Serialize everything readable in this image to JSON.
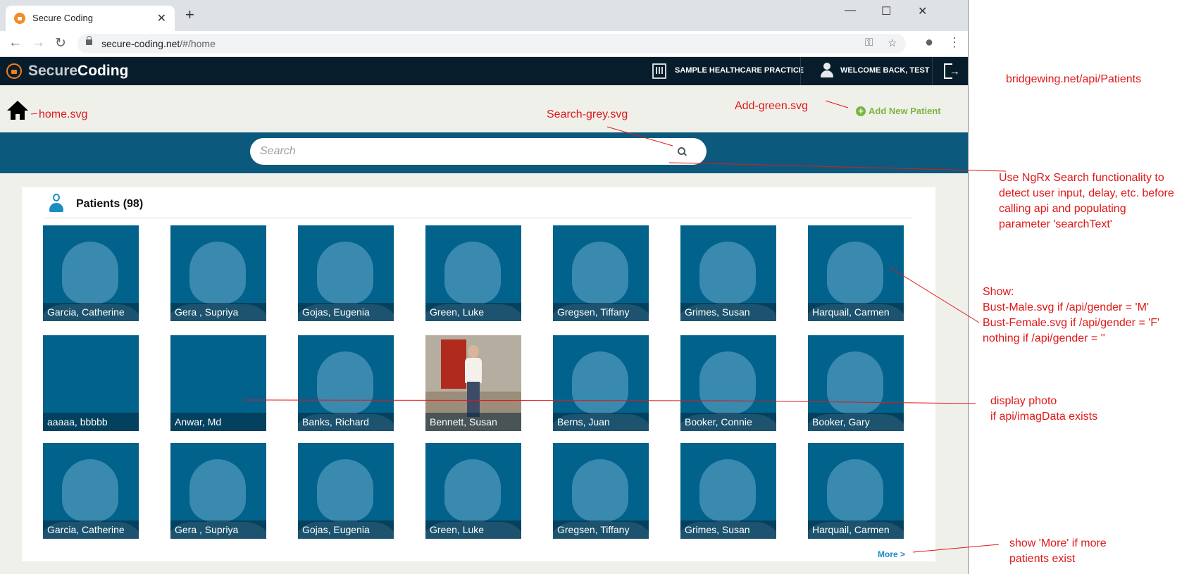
{
  "browser": {
    "tab_title": "Secure Coding",
    "tab_close": "✕",
    "new_tab": "+",
    "url_host": "secure-coding.net",
    "url_path": "/#/home",
    "window_controls": [
      "—",
      "☐",
      "✕"
    ],
    "icons": [
      "back-icon",
      "forward-icon",
      "reload-icon",
      "key-icon",
      "star-icon",
      "profile-icon",
      "menu-icon"
    ]
  },
  "app": {
    "logo_part1": "Secure",
    "logo_part2": "Coding",
    "practice": "SAMPLE HEALTHCARE PRACTICE",
    "welcome": "WELCOME BACK, TEST"
  },
  "page": {
    "add_new_patient": "Add New Patient",
    "search_placeholder": "Search",
    "patients_title": "Patients (98)",
    "more": "More >"
  },
  "patients": [
    [
      "Garcia, Catherine",
      "Gera , Supriya",
      "Gojas, Eugenia",
      "Green, Luke",
      "Gregsen, Tiffany",
      "Grimes, Susan",
      "Harquail, Carmen"
    ],
    [
      "aaaaa, bbbbb",
      "Anwar, Md",
      "Banks, Richard",
      "Bennett, Susan",
      "Berns, Juan",
      "Booker, Connie",
      "Booker, Gary"
    ],
    [
      "Garcia, Catherine",
      "Gera , Supriya",
      "Gojas, Eugenia",
      "Green, Luke",
      "Gregsen, Tiffany",
      "Grimes, Susan",
      "Harquail, Carmen"
    ]
  ],
  "annotations": {
    "home": "home.svg",
    "search_grey": "Search-grey.svg",
    "add_green": "Add-green.svg",
    "api_url": "bridgewing.net/api/Patients",
    "ngrx": [
      "Use NgRx Search functionality to",
      "detect user input, delay, etc. before",
      "calling api and populating",
      "parameter 'searchText'"
    ],
    "show": [
      "Show:",
      "Bust-Male.svg if /api/gender = 'M'",
      "Bust-Female.svg if /api/gender = 'F'",
      "nothing if /api/gender = ''"
    ],
    "photo": [
      "display photo",
      "if api/imagData exists"
    ],
    "more": [
      "show 'More' if more",
      "patients exist"
    ]
  },
  "colors": {
    "header": "#081d2c",
    "search_band": "#0b5a7d",
    "tile": "#01628b",
    "accent_green": "#7ab540",
    "accent_orange": "#f07f1d",
    "annotation_red": "#e01818"
  }
}
